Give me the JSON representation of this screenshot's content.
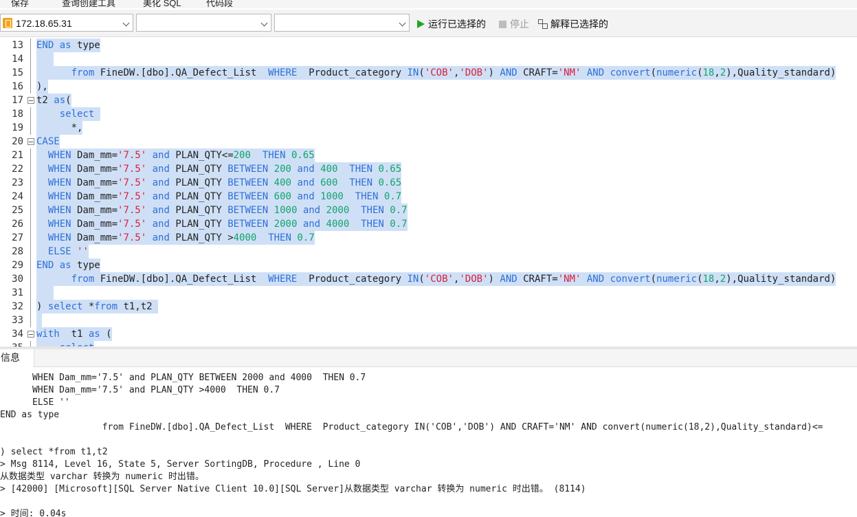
{
  "toolbar": {
    "save_label": "保存",
    "query_builder_label": "查询创建工具",
    "beautify_label": "美化 SQL",
    "snippet_label": "代码段",
    "connection_value": "172.18.65.31",
    "database_value": "",
    "schema_value": "",
    "run_selected_label": "运行已选择的",
    "stop_label": "停止",
    "explain_selected_label": "解释已选择的"
  },
  "editor": {
    "lines": [
      {
        "n": "13",
        "fold": false,
        "parts": [
          {
            "t": "kw",
            "s": "END"
          },
          {
            "t": "id",
            "s": " "
          },
          {
            "t": "kw",
            "s": "as"
          },
          {
            "t": "id",
            "s": " type"
          }
        ]
      },
      {
        "n": "14",
        "fold": false,
        "parts": [
          {
            "t": "id",
            "s": "   "
          }
        ]
      },
      {
        "n": "15",
        "fold": false,
        "parts": [
          {
            "t": "id",
            "s": "      "
          },
          {
            "t": "kw",
            "s": "from"
          },
          {
            "t": "id",
            "s": " FineDW.[dbo].QA_Defect_List  "
          },
          {
            "t": "kw",
            "s": "WHERE"
          },
          {
            "t": "id",
            "s": "  Product_category "
          },
          {
            "t": "kw",
            "s": "IN"
          },
          {
            "t": "id",
            "s": "("
          },
          {
            "t": "str",
            "s": "'COB'"
          },
          {
            "t": "id",
            "s": ","
          },
          {
            "t": "str",
            "s": "'DOB'"
          },
          {
            "t": "id",
            "s": ") "
          },
          {
            "t": "kw",
            "s": "AND"
          },
          {
            "t": "id",
            "s": " CRAFT="
          },
          {
            "t": "str",
            "s": "'NM'"
          },
          {
            "t": "id",
            "s": " "
          },
          {
            "t": "kw",
            "s": "AND"
          },
          {
            "t": "id",
            "s": " "
          },
          {
            "t": "kw",
            "s": "convert"
          },
          {
            "t": "id",
            "s": "("
          },
          {
            "t": "kw",
            "s": "numeric"
          },
          {
            "t": "id",
            "s": "("
          },
          {
            "t": "num",
            "s": "18"
          },
          {
            "t": "id",
            "s": ","
          },
          {
            "t": "num",
            "s": "2"
          },
          {
            "t": "id",
            "s": "),Quality_standard)"
          }
        ]
      },
      {
        "n": "16",
        "fold": false,
        "parts": [
          {
            "t": "id",
            "s": "),"
          }
        ]
      },
      {
        "n": "17",
        "fold": true,
        "parts": [
          {
            "t": "id",
            "s": "t2 "
          },
          {
            "t": "kw",
            "s": "as"
          },
          {
            "t": "id",
            "s": "("
          }
        ]
      },
      {
        "n": "18",
        "fold": false,
        "parts": [
          {
            "t": "id",
            "s": "    "
          },
          {
            "t": "kw",
            "s": "select"
          },
          {
            "t": "id",
            "s": " "
          }
        ]
      },
      {
        "n": "19",
        "fold": false,
        "parts": [
          {
            "t": "id",
            "s": "      *,"
          }
        ]
      },
      {
        "n": "20",
        "fold": true,
        "parts": [
          {
            "t": "kw",
            "s": "CASE"
          }
        ]
      },
      {
        "n": "21",
        "fold": false,
        "parts": [
          {
            "t": "id",
            "s": "  "
          },
          {
            "t": "kw",
            "s": "WHEN"
          },
          {
            "t": "id",
            "s": " Dam_mm="
          },
          {
            "t": "str",
            "s": "'7.5'"
          },
          {
            "t": "id",
            "s": " "
          },
          {
            "t": "kw",
            "s": "and"
          },
          {
            "t": "id",
            "s": " PLAN_QTY<="
          },
          {
            "t": "num",
            "s": "200"
          },
          {
            "t": "id",
            "s": "  "
          },
          {
            "t": "kw",
            "s": "THEN"
          },
          {
            "t": "id",
            "s": " "
          },
          {
            "t": "num",
            "s": "0.65"
          }
        ]
      },
      {
        "n": "22",
        "fold": false,
        "parts": [
          {
            "t": "id",
            "s": "  "
          },
          {
            "t": "kw",
            "s": "WHEN"
          },
          {
            "t": "id",
            "s": " Dam_mm="
          },
          {
            "t": "str",
            "s": "'7.5'"
          },
          {
            "t": "id",
            "s": " "
          },
          {
            "t": "kw",
            "s": "and"
          },
          {
            "t": "id",
            "s": " PLAN_QTY "
          },
          {
            "t": "kw",
            "s": "BETWEEN"
          },
          {
            "t": "id",
            "s": " "
          },
          {
            "t": "num",
            "s": "200"
          },
          {
            "t": "id",
            "s": " "
          },
          {
            "t": "kw",
            "s": "and"
          },
          {
            "t": "id",
            "s": " "
          },
          {
            "t": "num",
            "s": "400"
          },
          {
            "t": "id",
            "s": "  "
          },
          {
            "t": "kw",
            "s": "THEN"
          },
          {
            "t": "id",
            "s": " "
          },
          {
            "t": "num",
            "s": "0.65"
          }
        ]
      },
      {
        "n": "23",
        "fold": false,
        "parts": [
          {
            "t": "id",
            "s": "  "
          },
          {
            "t": "kw",
            "s": "WHEN"
          },
          {
            "t": "id",
            "s": " Dam_mm="
          },
          {
            "t": "str",
            "s": "'7.5'"
          },
          {
            "t": "id",
            "s": " "
          },
          {
            "t": "kw",
            "s": "and"
          },
          {
            "t": "id",
            "s": " PLAN_QTY "
          },
          {
            "t": "kw",
            "s": "BETWEEN"
          },
          {
            "t": "id",
            "s": " "
          },
          {
            "t": "num",
            "s": "400"
          },
          {
            "t": "id",
            "s": " "
          },
          {
            "t": "kw",
            "s": "and"
          },
          {
            "t": "id",
            "s": " "
          },
          {
            "t": "num",
            "s": "600"
          },
          {
            "t": "id",
            "s": "  "
          },
          {
            "t": "kw",
            "s": "THEN"
          },
          {
            "t": "id",
            "s": " "
          },
          {
            "t": "num",
            "s": "0.65"
          }
        ]
      },
      {
        "n": "24",
        "fold": false,
        "parts": [
          {
            "t": "id",
            "s": "  "
          },
          {
            "t": "kw",
            "s": "WHEN"
          },
          {
            "t": "id",
            "s": " Dam_mm="
          },
          {
            "t": "str",
            "s": "'7.5'"
          },
          {
            "t": "id",
            "s": " "
          },
          {
            "t": "kw",
            "s": "and"
          },
          {
            "t": "id",
            "s": " PLAN_QTY "
          },
          {
            "t": "kw",
            "s": "BETWEEN"
          },
          {
            "t": "id",
            "s": " "
          },
          {
            "t": "num",
            "s": "600"
          },
          {
            "t": "id",
            "s": " "
          },
          {
            "t": "kw",
            "s": "and"
          },
          {
            "t": "id",
            "s": " "
          },
          {
            "t": "num",
            "s": "1000"
          },
          {
            "t": "id",
            "s": "  "
          },
          {
            "t": "kw",
            "s": "THEN"
          },
          {
            "t": "id",
            "s": " "
          },
          {
            "t": "num",
            "s": "0.7"
          }
        ]
      },
      {
        "n": "25",
        "fold": false,
        "parts": [
          {
            "t": "id",
            "s": "  "
          },
          {
            "t": "kw",
            "s": "WHEN"
          },
          {
            "t": "id",
            "s": " Dam_mm="
          },
          {
            "t": "str",
            "s": "'7.5'"
          },
          {
            "t": "id",
            "s": " "
          },
          {
            "t": "kw",
            "s": "and"
          },
          {
            "t": "id",
            "s": " PLAN_QTY "
          },
          {
            "t": "kw",
            "s": "BETWEEN"
          },
          {
            "t": "id",
            "s": " "
          },
          {
            "t": "num",
            "s": "1000"
          },
          {
            "t": "id",
            "s": " "
          },
          {
            "t": "kw",
            "s": "and"
          },
          {
            "t": "id",
            "s": " "
          },
          {
            "t": "num",
            "s": "2000"
          },
          {
            "t": "id",
            "s": "  "
          },
          {
            "t": "kw",
            "s": "THEN"
          },
          {
            "t": "id",
            "s": " "
          },
          {
            "t": "num",
            "s": "0.7"
          }
        ]
      },
      {
        "n": "26",
        "fold": false,
        "parts": [
          {
            "t": "id",
            "s": "  "
          },
          {
            "t": "kw",
            "s": "WHEN"
          },
          {
            "t": "id",
            "s": " Dam_mm="
          },
          {
            "t": "str",
            "s": "'7.5'"
          },
          {
            "t": "id",
            "s": " "
          },
          {
            "t": "kw",
            "s": "and"
          },
          {
            "t": "id",
            "s": " PLAN_QTY "
          },
          {
            "t": "kw",
            "s": "BETWEEN"
          },
          {
            "t": "id",
            "s": " "
          },
          {
            "t": "num",
            "s": "2000"
          },
          {
            "t": "id",
            "s": " "
          },
          {
            "t": "kw",
            "s": "and"
          },
          {
            "t": "id",
            "s": " "
          },
          {
            "t": "num",
            "s": "4000"
          },
          {
            "t": "id",
            "s": "  "
          },
          {
            "t": "kw",
            "s": "THEN"
          },
          {
            "t": "id",
            "s": " "
          },
          {
            "t": "num",
            "s": "0.7"
          }
        ]
      },
      {
        "n": "27",
        "fold": false,
        "parts": [
          {
            "t": "id",
            "s": "  "
          },
          {
            "t": "kw",
            "s": "WHEN"
          },
          {
            "t": "id",
            "s": " Dam_mm="
          },
          {
            "t": "str",
            "s": "'7.5'"
          },
          {
            "t": "id",
            "s": " "
          },
          {
            "t": "kw",
            "s": "and"
          },
          {
            "t": "id",
            "s": " PLAN_QTY >"
          },
          {
            "t": "num",
            "s": "4000"
          },
          {
            "t": "id",
            "s": "  "
          },
          {
            "t": "kw",
            "s": "THEN"
          },
          {
            "t": "id",
            "s": " "
          },
          {
            "t": "num",
            "s": "0.7"
          }
        ]
      },
      {
        "n": "28",
        "fold": false,
        "parts": [
          {
            "t": "id",
            "s": "  "
          },
          {
            "t": "kw",
            "s": "ELSE"
          },
          {
            "t": "id",
            "s": " "
          },
          {
            "t": "str",
            "s": "''"
          }
        ]
      },
      {
        "n": "29",
        "fold": false,
        "parts": [
          {
            "t": "kw",
            "s": "END"
          },
          {
            "t": "id",
            "s": " "
          },
          {
            "t": "kw",
            "s": "as"
          },
          {
            "t": "id",
            "s": " type"
          }
        ]
      },
      {
        "n": "30",
        "fold": false,
        "parts": [
          {
            "t": "id",
            "s": "      "
          },
          {
            "t": "kw",
            "s": "from"
          },
          {
            "t": "id",
            "s": " FineDW.[dbo].QA_Defect_List  "
          },
          {
            "t": "kw",
            "s": "WHERE"
          },
          {
            "t": "id",
            "s": "  Product_category "
          },
          {
            "t": "kw",
            "s": "IN"
          },
          {
            "t": "id",
            "s": "("
          },
          {
            "t": "str",
            "s": "'COB'"
          },
          {
            "t": "id",
            "s": ","
          },
          {
            "t": "str",
            "s": "'DOB'"
          },
          {
            "t": "id",
            "s": ") "
          },
          {
            "t": "kw",
            "s": "AND"
          },
          {
            "t": "id",
            "s": " CRAFT="
          },
          {
            "t": "str",
            "s": "'NM'"
          },
          {
            "t": "id",
            "s": " "
          },
          {
            "t": "kw",
            "s": "AND"
          },
          {
            "t": "id",
            "s": " "
          },
          {
            "t": "kw",
            "s": "convert"
          },
          {
            "t": "id",
            "s": "("
          },
          {
            "t": "kw",
            "s": "numeric"
          },
          {
            "t": "id",
            "s": "("
          },
          {
            "t": "num",
            "s": "18"
          },
          {
            "t": "id",
            "s": ","
          },
          {
            "t": "num",
            "s": "2"
          },
          {
            "t": "id",
            "s": "),Quality_standard)"
          }
        ]
      },
      {
        "n": "31",
        "fold": false,
        "parts": [
          {
            "t": "id",
            "s": "   "
          }
        ]
      },
      {
        "n": "32",
        "fold": false,
        "parts": [
          {
            "t": "id",
            "s": ") "
          },
          {
            "t": "kw",
            "s": "select"
          },
          {
            "t": "id",
            "s": " *"
          },
          {
            "t": "kw",
            "s": "from"
          },
          {
            "t": "id",
            "s": " t1,t2 "
          }
        ]
      },
      {
        "n": "33",
        "fold": false,
        "parts": [
          {
            "t": "id",
            "s": " "
          }
        ]
      },
      {
        "n": "34",
        "fold": true,
        "parts": [
          {
            "t": "kw",
            "s": "with"
          },
          {
            "t": "id",
            "s": "  t1 "
          },
          {
            "t": "kw",
            "s": "as"
          },
          {
            "t": "id",
            "s": " ("
          }
        ]
      },
      {
        "n": "35",
        "fold": false,
        "parts": [
          {
            "t": "id",
            "s": "    "
          },
          {
            "t": "kw",
            "s": "select"
          }
        ]
      }
    ]
  },
  "bottom": {
    "tab_label": "信息",
    "messages": [
      "      WHEN Dam_mm='7.5' and PLAN_QTY BETWEEN 2000 and 4000  THEN 0.7",
      "      WHEN Dam_mm='7.5' and PLAN_QTY >4000  THEN 0.7",
      "      ELSE ''",
      "END as type",
      "                   from FineDW.[dbo].QA_Defect_List  WHERE  Product_category IN('COB','DOB') AND CRAFT='NM' AND convert(numeric(18,2),Quality_standard)<=",
      "",
      ") select *from t1,t2",
      "> Msg 8114, Level 16, State 5, Server SortingDB, Procedure , Line 0",
      "从数据类型 varchar 转换为 numeric 时出错。",
      "> [42000] [Microsoft][SQL Server Native Client 10.0][SQL Server]从数据类型 varchar 转换为 numeric 时出错。 (8114)",
      "",
      "> 时间: 0.04s"
    ]
  }
}
